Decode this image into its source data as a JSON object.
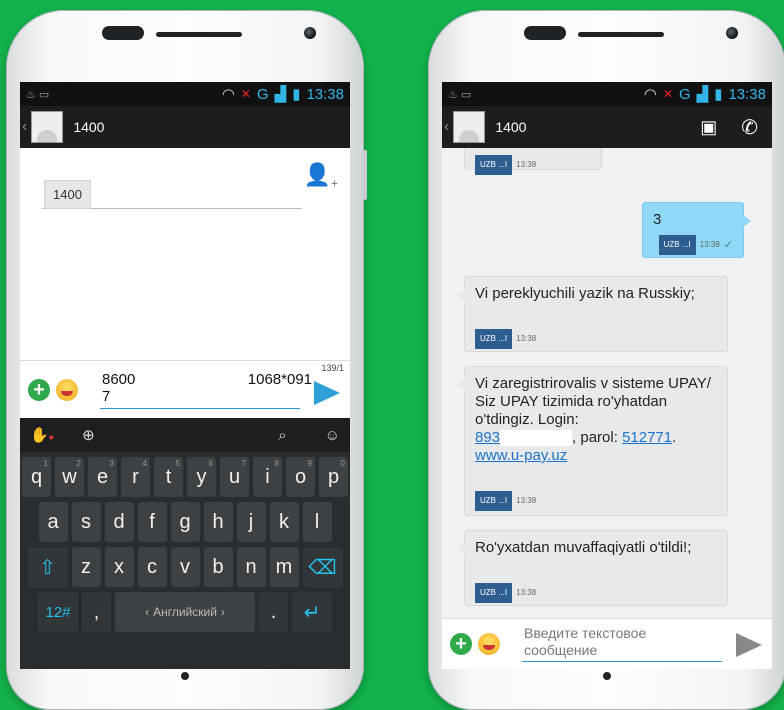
{
  "left_phone": {
    "status": {
      "time": "13:38",
      "network": "G"
    },
    "contact_name": "1400",
    "recipient_chip": "1400",
    "compose_line1_a": "8600",
    "compose_line1_b": "1068*091",
    "compose_line2": "7",
    "char_counter": "139/1",
    "keyboard": {
      "row1": [
        "q",
        "w",
        "e",
        "r",
        "t",
        "y",
        "u",
        "i",
        "o",
        "p"
      ],
      "row1_alt": [
        "1",
        "2",
        "3",
        "4",
        "5",
        "6",
        "7",
        "8",
        "9",
        "0"
      ],
      "row2": [
        "a",
        "s",
        "d",
        "f",
        "g",
        "h",
        "j",
        "k",
        "l"
      ],
      "row3": [
        "z",
        "x",
        "c",
        "v",
        "b",
        "n",
        "m"
      ],
      "symbols_label": "12#",
      "space_label": "Английский",
      "period_label": "."
    }
  },
  "right_phone": {
    "status": {
      "time": "13:38",
      "network": "G"
    },
    "contact_name": "1400",
    "messages": [
      {
        "text": "",
        "tag": "UZB ...I",
        "time": "13:38"
      },
      {
        "text": "3",
        "tag": "UZB ...I",
        "time": "13:38"
      },
      {
        "text": "Vi pereklyuchili yazik na Russkiy;",
        "tag": "UZB ...I",
        "time": "13:38"
      },
      {
        "text_a": "Vi zaregistrirovalis v sisteme UPAY/ Siz UPAY tizimida ro'yhatdan o'tdingiz. Login:",
        "link_login": "893",
        "text_b": ", parol:",
        "link_pass": "512771",
        "text_c": ".",
        "link_site": "www.u-pay.uz",
        "tag": "UZB ...I",
        "time": "13:38"
      },
      {
        "text": "Ro'yxatdan muvaffaqiyatli o'tildi!;",
        "tag": "UZB ...I",
        "time": "13:38"
      }
    ],
    "compose_placeholder_1": "Введите текстовое",
    "compose_placeholder_2": "сообщение"
  },
  "colors": {
    "background": "#12b34c",
    "accent": "#2f9fd8",
    "sent_bubble": "#8fd9f6"
  }
}
